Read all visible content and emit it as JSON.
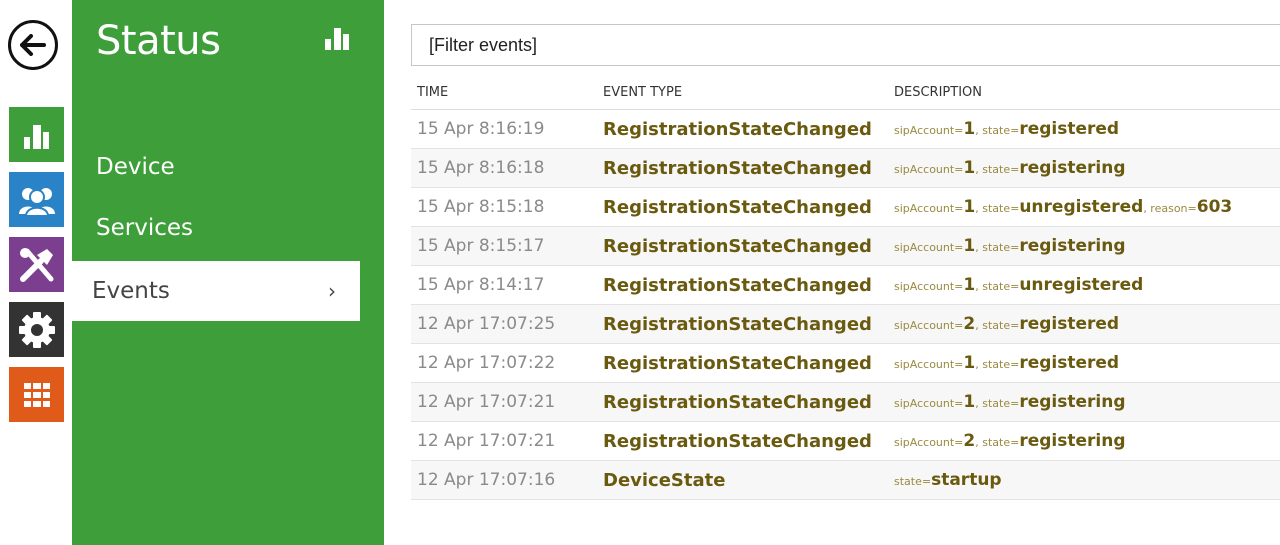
{
  "rail": {
    "items": [
      {
        "icon": "status-chart-icon",
        "color": "#3e9f3a"
      },
      {
        "icon": "users-icon",
        "color": "#2a83c6"
      },
      {
        "icon": "tools-icon",
        "color": "#7c3f8f"
      },
      {
        "icon": "gear-icon",
        "color": "#333333"
      },
      {
        "icon": "grid-icon",
        "color": "#e05a1a"
      }
    ]
  },
  "nav": {
    "title": "Status",
    "items": [
      {
        "label": "Device"
      },
      {
        "label": "Services"
      },
      {
        "label": "Events",
        "chevron": "›"
      }
    ]
  },
  "filter": {
    "placeholder": "[Filter events]"
  },
  "table": {
    "headers": {
      "time": "TIME",
      "type": "EVENT TYPE",
      "desc": "DESCRIPTION"
    },
    "rows": [
      {
        "time": "15 Apr 8:16:19",
        "type": "RegistrationStateChanged",
        "desc": [
          [
            "sipAccount=",
            "1"
          ],
          [
            ", state=",
            "registered"
          ]
        ]
      },
      {
        "time": "15 Apr 8:16:18",
        "type": "RegistrationStateChanged",
        "desc": [
          [
            "sipAccount=",
            "1"
          ],
          [
            ", state=",
            "registering"
          ]
        ]
      },
      {
        "time": "15 Apr 8:15:18",
        "type": "RegistrationStateChanged",
        "desc": [
          [
            "sipAccount=",
            "1"
          ],
          [
            ", state=",
            "unregistered"
          ],
          [
            ", reason=",
            "603"
          ]
        ]
      },
      {
        "time": "15 Apr 8:15:17",
        "type": "RegistrationStateChanged",
        "desc": [
          [
            "sipAccount=",
            "1"
          ],
          [
            ", state=",
            "registering"
          ]
        ]
      },
      {
        "time": "15 Apr 8:14:17",
        "type": "RegistrationStateChanged",
        "desc": [
          [
            "sipAccount=",
            "1"
          ],
          [
            ", state=",
            "unregistered"
          ]
        ]
      },
      {
        "time": "12 Apr 17:07:25",
        "type": "RegistrationStateChanged",
        "desc": [
          [
            "sipAccount=",
            "2"
          ],
          [
            ", state=",
            "registered"
          ]
        ]
      },
      {
        "time": "12 Apr 17:07:22",
        "type": "RegistrationStateChanged",
        "desc": [
          [
            "sipAccount=",
            "1"
          ],
          [
            ", state=",
            "registered"
          ]
        ]
      },
      {
        "time": "12 Apr 17:07:21",
        "type": "RegistrationStateChanged",
        "desc": [
          [
            "sipAccount=",
            "1"
          ],
          [
            ", state=",
            "registering"
          ]
        ]
      },
      {
        "time": "12 Apr 17:07:21",
        "type": "RegistrationStateChanged",
        "desc": [
          [
            "sipAccount=",
            "2"
          ],
          [
            ", state=",
            "registering"
          ]
        ]
      },
      {
        "time": "12 Apr 17:07:16",
        "type": "DeviceState",
        "desc": [
          [
            "state=",
            "startup"
          ]
        ]
      }
    ]
  }
}
